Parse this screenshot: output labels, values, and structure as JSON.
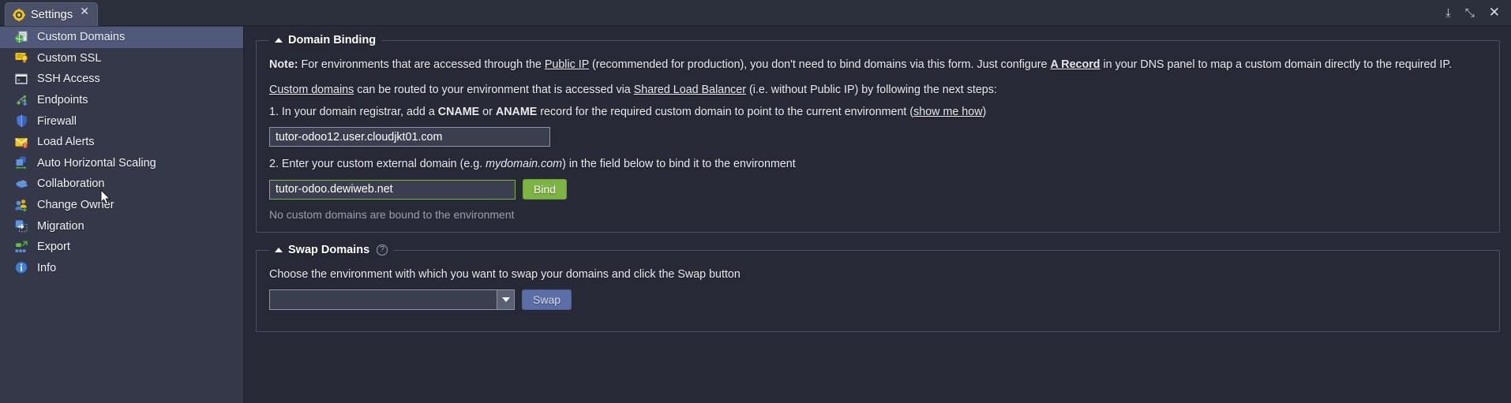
{
  "window": {
    "tab": {
      "label": "Settings",
      "icon": "gear-icon",
      "close": "✕"
    },
    "controls": {
      "download": "⤓",
      "expand": "⤡",
      "close": "✕"
    }
  },
  "sidebar": {
    "items": [
      {
        "label": "Custom Domains",
        "icon": "globe-document-icon",
        "selected": true
      },
      {
        "label": "Custom SSL",
        "icon": "certificate-icon",
        "selected": false
      },
      {
        "label": "SSH Access",
        "icon": "terminal-icon",
        "selected": false
      },
      {
        "label": "Endpoints",
        "icon": "endpoints-icon",
        "selected": false
      },
      {
        "label": "Firewall",
        "icon": "shield-icon",
        "selected": false
      },
      {
        "label": "Load Alerts",
        "icon": "envelope-alert-icon",
        "selected": false
      },
      {
        "label": "Auto Horizontal Scaling",
        "icon": "scaling-icon",
        "selected": false
      },
      {
        "label": "Collaboration",
        "icon": "handshake-icon",
        "selected": false
      },
      {
        "label": "Change Owner",
        "icon": "users-change-icon",
        "selected": false
      },
      {
        "label": "Migration",
        "icon": "migration-icon",
        "selected": false
      },
      {
        "label": "Export",
        "icon": "export-icon",
        "selected": false
      },
      {
        "label": "Info",
        "icon": "info-icon",
        "selected": false
      }
    ]
  },
  "domain_binding": {
    "legend": "Domain Binding",
    "note_label": "Note:",
    "note_part1": " For environments that are accessed through the ",
    "note_link1": "Public IP",
    "note_part2": " (recommended for production), you don't need to bind domains via this form. Just configure ",
    "note_link2": "A Record",
    "note_part3": " in your DNS panel to map a custom domain directly to the required IP.",
    "routed_link1": "Custom domains",
    "routed_part1": " can be routed to your environment that is accessed via ",
    "routed_link2": "Shared Load Balancer",
    "routed_part2": " (i.e. without Public IP) by following the next steps:",
    "step1_pre": "1. In your domain registrar, add a ",
    "step1_cname": "CNAME",
    "step1_or": " or ",
    "step1_aname": "ANAME",
    "step1_post": " record for the required custom domain to point to the current environment (",
    "step1_link": "show me how",
    "step1_end": ")",
    "env_domain_value": "tutor-odoo12.user.cloudjkt01.com",
    "step2_pre": "2. Enter your custom external domain (e.g. ",
    "step2_example": "mydomain.com",
    "step2_post": ") in the field below to bind it to the environment",
    "custom_domain_value": "tutor-odoo.dewiweb.net",
    "custom_domain_placeholder": "",
    "bind_button": "Bind",
    "status": "No custom domains are bound to the environment"
  },
  "swap_domains": {
    "legend": "Swap Domains",
    "help_icon": "?",
    "description": "Choose the environment with which you want to swap your domains and click the Swap button",
    "select_value": "",
    "select_placeholder": "",
    "swap_button": "Swap"
  },
  "colors": {
    "accent_green": "#7cb342",
    "accent_blue": "#5b6ea8",
    "selection": "#50597a",
    "panel_bg": "#272a36",
    "sidebar_bg": "#353849"
  }
}
